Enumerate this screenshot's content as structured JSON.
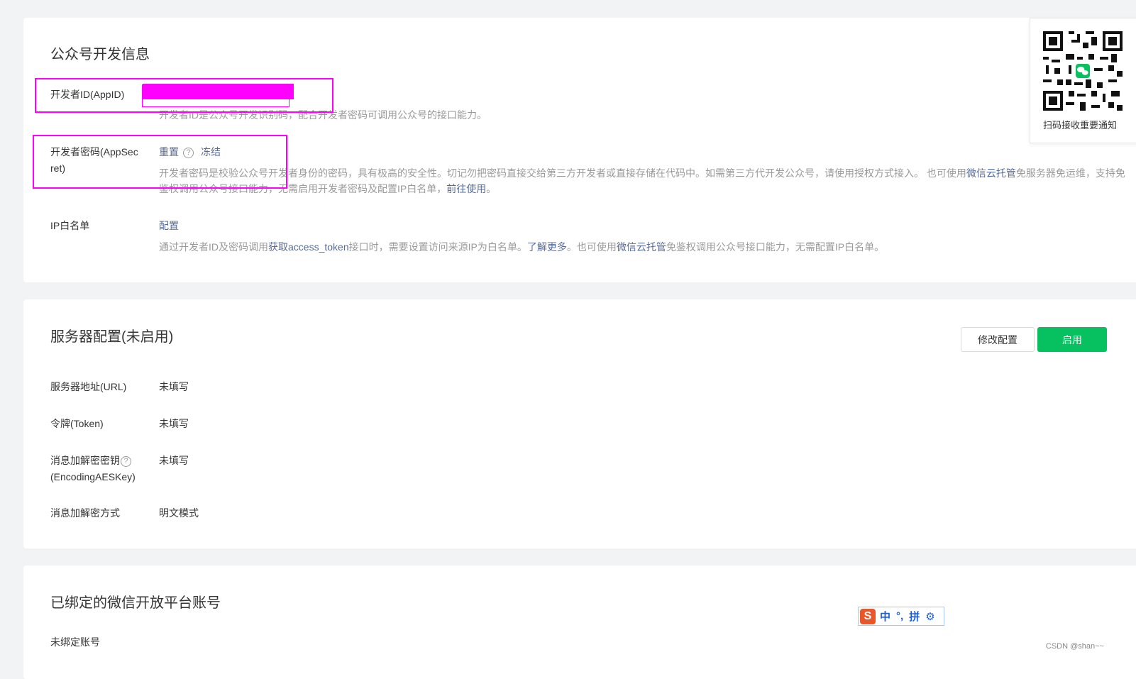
{
  "dev_info": {
    "title": "公众号开发信息",
    "appid": {
      "label": "开发者ID(AppID)",
      "desc": "开发者ID是公众号开发识别码，配合开发者密码可调用公众号的接口能力。"
    },
    "appsecret": {
      "label_line1": "开发者密码(AppSec",
      "label_line2": "ret)",
      "reset": "重置",
      "help": "?",
      "freeze": "冻结",
      "desc_part1": "开发者密码是校验公众号开发者身份的密码，具有极高的安全性。切记勿把密码直接交给第三方开发者或直接存储在代码中。如需第三方代开发公众号，请使用授权方式接入。 也可使用",
      "desc_link1": "微信云托管",
      "desc_part2": "免服务器免运维，支持免",
      "desc_part3": "鉴权调用公众号接口能力，无需启用开发者密码及配置IP白名单，",
      "desc_link2": "前往使用",
      "desc_part4": "。"
    },
    "ip_whitelist": {
      "label": "IP白名单",
      "config": "配置",
      "desc_part1": "通过开发者ID及密码调用",
      "desc_link1": "获取access_token",
      "desc_part2": "接口时，需要设置访问来源IP为白名单。",
      "desc_link2": "了解更多",
      "desc_part3": "。也可使用",
      "desc_link3": "微信云托管",
      "desc_part4": "免鉴权调用公众号接口能力，无需配置IP白名单。"
    }
  },
  "qr": {
    "caption": "扫码接收重要通知"
  },
  "server_config": {
    "title": "服务器配置(未启用)",
    "modify_button": "修改配置",
    "enable_button": "启用",
    "rows": [
      {
        "label": "服务器地址(URL)",
        "value": "未填写"
      },
      {
        "label": "令牌(Token)",
        "value": "未填写"
      },
      {
        "label_line1": "消息加解密密钥",
        "label_line2": "(EncodingAESKey)",
        "value": "未填写"
      },
      {
        "label": "消息加解密方式",
        "value": "明文模式"
      }
    ],
    "help": "?"
  },
  "open_platform": {
    "title": "已绑定的微信开放平台账号",
    "status": "未绑定账号"
  },
  "ime": {
    "mode": "中",
    "punct": "°,",
    "pinyin": "拼",
    "gear": "⚙"
  },
  "watermark": "CSDN @shan~~",
  "colors": {
    "accent_green": "#07c160",
    "link_blue": "#576b95",
    "highlight_magenta": "#ff00ff"
  }
}
